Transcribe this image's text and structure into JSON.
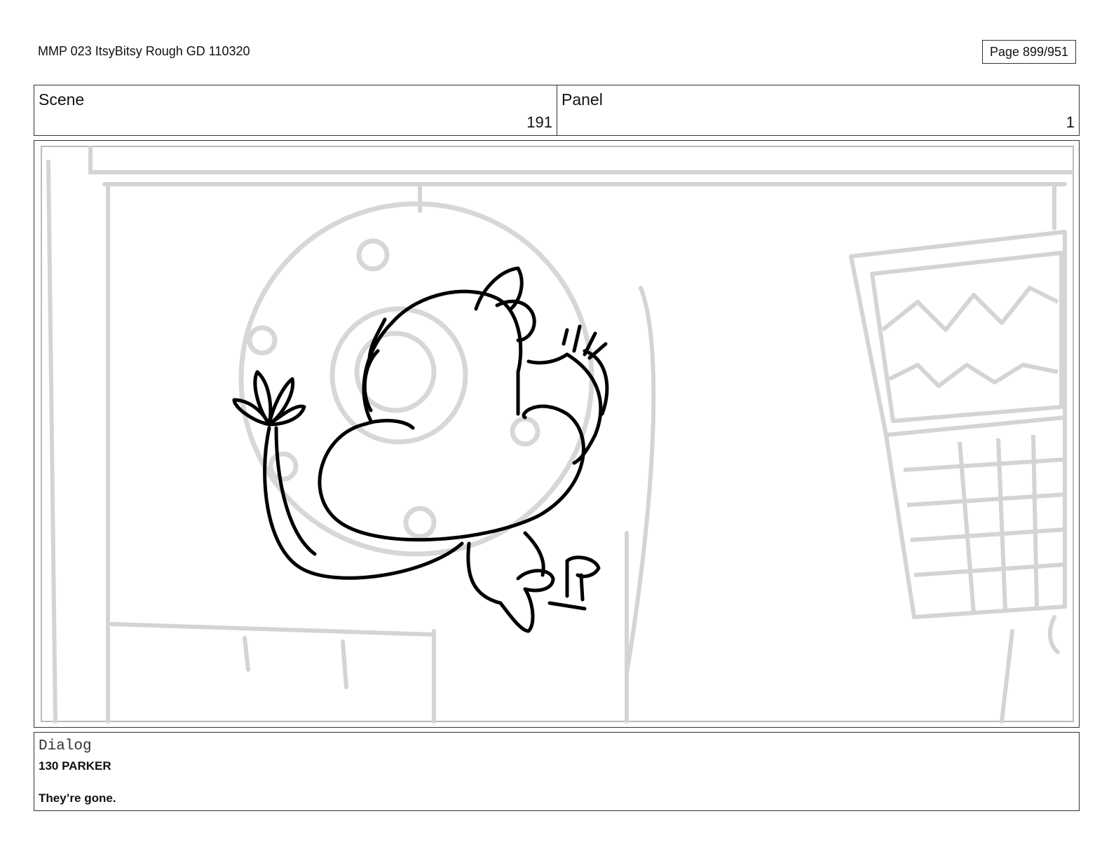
{
  "document": {
    "title": "MMP 023 ItsyBitsy Rough GD 110320",
    "page": "Page 899/951"
  },
  "header": {
    "scene_label": "Scene",
    "scene_value": "191",
    "panel_label": "Panel",
    "panel_value": "1"
  },
  "artwork": {
    "description_icon": "storyboard-sketch-icon"
  },
  "dialog": {
    "label": "Dialog",
    "speaker": "130 PARKER",
    "line": "They’re gone."
  }
}
